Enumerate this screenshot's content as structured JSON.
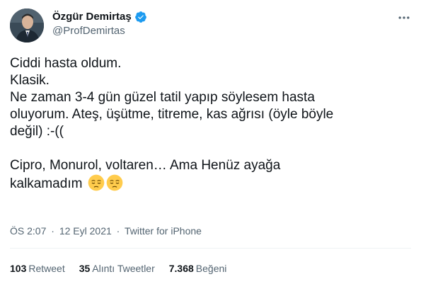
{
  "author": {
    "display_name": "Özgür Demirtaş",
    "handle": "@ProfDemirtas",
    "verified": true,
    "verified_color": "#1d9bf0"
  },
  "menu": {
    "icon": "more-horizontal-icon"
  },
  "tweet": {
    "lines": [
      "Ciddi hasta oldum.",
      "Klasik.",
      "Ne zaman 3-4 gün güzel tatil yapıp söylesem hasta",
      "oluyorum. Ateş, üşütme, titreme, kas ağrısı (öyle böyle",
      "değil) :-((",
      "Cipro, Monurol, voltaren… Ama Henüz ayağa",
      "kalkamadım"
    ],
    "emoji": [
      "pensive-face-emoji",
      "pensive-face-emoji"
    ]
  },
  "meta": {
    "time": "ÖS 2:07",
    "separator": "·",
    "date": "12 Eyl 2021",
    "source": "Twitter for iPhone"
  },
  "stats": {
    "retweets": {
      "count": "103",
      "label": "Retweet"
    },
    "quotes": {
      "count": "35",
      "label": "Alıntı Tweetler"
    },
    "likes": {
      "count": "7.368",
      "label": "Beğeni"
    }
  },
  "colors": {
    "text": "#0f1419",
    "secondary": "#536471",
    "divider": "#eff3f4",
    "emoji_face": "#ffcc4d"
  }
}
